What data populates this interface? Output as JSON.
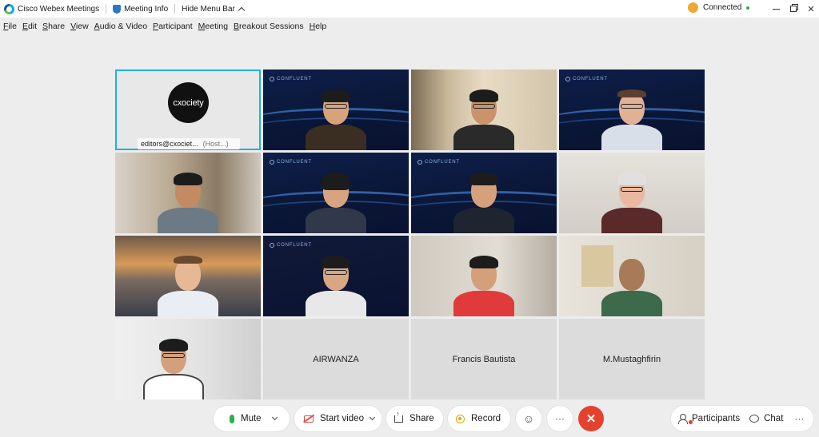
{
  "titlebar": {
    "app_name": "Cisco Webex Meetings",
    "meeting_info": "Meeting Info",
    "hide_menu": "Hide Menu Bar",
    "status": "Connected"
  },
  "menu": [
    "File",
    "Edit",
    "Share",
    "View",
    "Audio & Video",
    "Participant",
    "Meeting",
    "Breakout Sessions",
    "Help"
  ],
  "tiles": {
    "host_logo": "cxociety",
    "host_name": "editors@cxociet...",
    "host_tag": "(Host...)",
    "confluent": "CONFLUENT",
    "name_1": "AIRWANZA",
    "name_2": "Francis Bautista",
    "name_3": "M.Mustaghfirin"
  },
  "toolbar": {
    "mute": "Mute",
    "start_video": "Start video",
    "share": "Share",
    "record": "Record",
    "more": "···",
    "end": "✕",
    "participants": "Participants",
    "chat": "Chat"
  },
  "colors": {
    "accent": "#1cb3d8",
    "end_call": "#e5412f",
    "mic_on": "#2bb24c"
  }
}
